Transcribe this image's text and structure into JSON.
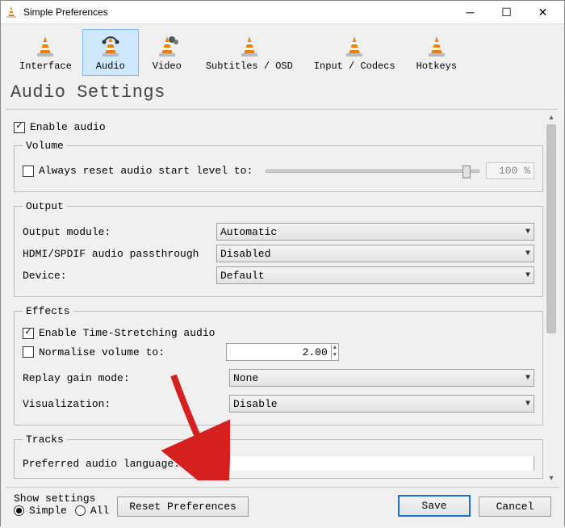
{
  "window": {
    "title": "Simple Preferences"
  },
  "tabs": [
    {
      "label": "Interface"
    },
    {
      "label": "Audio"
    },
    {
      "label": "Video"
    },
    {
      "label": "Subtitles / OSD"
    },
    {
      "label": "Input / Codecs"
    },
    {
      "label": "Hotkeys"
    }
  ],
  "page_title": "Audio Settings",
  "enable_audio": {
    "label": "Enable audio"
  },
  "volume": {
    "legend": "Volume",
    "reset_label": "Always reset audio start level to:",
    "pct": "100 %"
  },
  "output": {
    "legend": "Output",
    "module_label": "Output module:",
    "module_value": "Automatic",
    "passthrough_label": "HDMI/SPDIF audio passthrough",
    "passthrough_value": "Disabled",
    "device_label": "Device:",
    "device_value": "Default"
  },
  "effects": {
    "legend": "Effects",
    "timestretch_label": "Enable Time-Stretching audio",
    "normalise_label": "Normalise volume to:",
    "normalise_value": "2.00",
    "replay_label": "Replay gain mode:",
    "replay_value": "None",
    "viz_label": "Visualization:",
    "viz_value": "Disable"
  },
  "tracks": {
    "legend": "Tracks",
    "pref_lang_label": "Preferred audio language:"
  },
  "bottom": {
    "show_settings": "Show settings",
    "simple": "Simple",
    "all": "All",
    "reset": "Reset Preferences",
    "save": "Save",
    "cancel": "Cancel"
  }
}
